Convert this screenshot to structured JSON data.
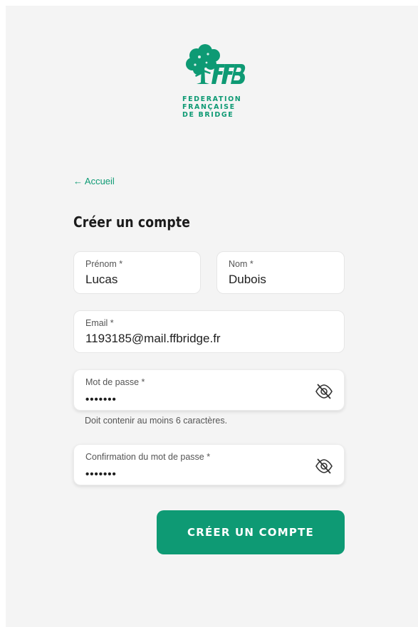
{
  "brand": {
    "name": "FFB",
    "lines": [
      "FEDERATION",
      "FRANÇAISE",
      "DE BRIDGE"
    ],
    "color": "#0e9a74"
  },
  "nav": {
    "back_label": "← Accueil"
  },
  "form": {
    "title": "Créer un compte",
    "first_name": {
      "label": "Prénom *",
      "value": "Lucas"
    },
    "last_name": {
      "label": "Nom *",
      "value": "Dubois"
    },
    "email": {
      "label": "Email *",
      "value": "1193185@mail.ffbridge.fr"
    },
    "password": {
      "label": "Mot de passe *",
      "value": "•••••••",
      "hint": "Doit contenir au moins 6 caractères.",
      "toggle_icon": "eye-off-icon"
    },
    "password_confirm": {
      "label": "Confirmation du mot de passe *",
      "value": "•••••••",
      "toggle_icon": "eye-off-icon"
    },
    "submit_label": "CRÉER UN COMPTE"
  }
}
